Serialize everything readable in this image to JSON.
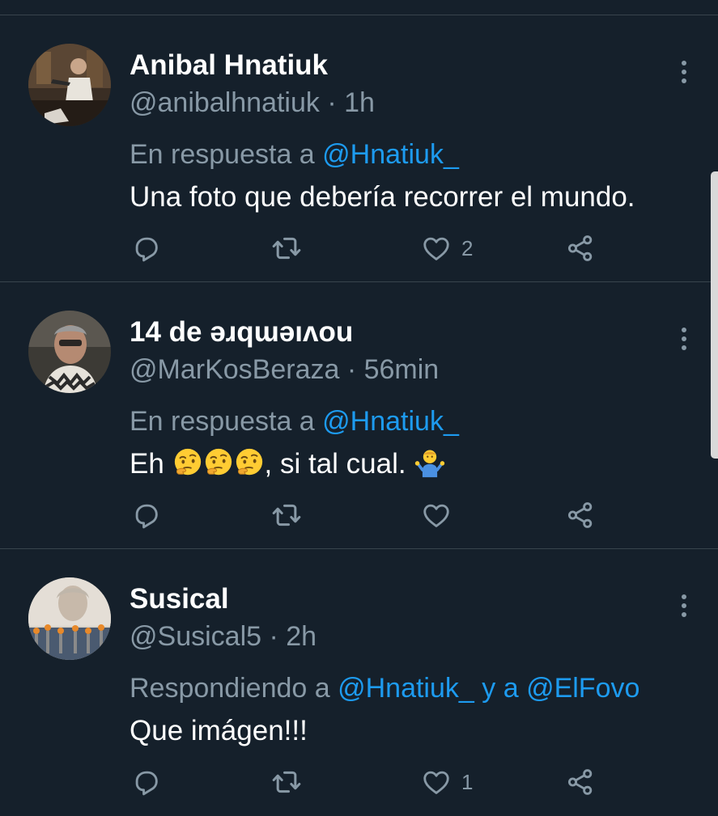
{
  "colors": {
    "background": "#15202b",
    "divider": "#38444d",
    "secondary_text": "#8899a6",
    "accent": "#1d9bf0",
    "primary_text": "#ffffff"
  },
  "tweets": [
    {
      "name": "Anibal Hnatiuk",
      "handle": "@anibalhnatiuk",
      "separator": " · ",
      "time": "1h",
      "reply_prefix": "En respuesta a ",
      "reply_to": "@Hnatiuk_",
      "text": "Una foto que debería recorrer el mundo.",
      "likes": "2",
      "avatar_icon": "avatar-anibal"
    },
    {
      "name": "14 de ǝɹqɯǝıʌou",
      "handle": "@MarKosBeraza",
      "separator": " · ",
      "time": "56min",
      "reply_prefix": "En respuesta a ",
      "reply_to": "@Hnatiuk_",
      "text_start": "Eh ",
      "text_end": ", si tal cual. ",
      "emojis": [
        "thinking-face-emoji",
        "thinking-face-emoji",
        "thinking-face-emoji",
        "man-shrugging-emoji"
      ],
      "likes": "",
      "avatar_icon": "avatar-markos"
    },
    {
      "name": "Susical",
      "handle": "@Susical5",
      "separator": " · ",
      "time": "2h",
      "reply_prefix": "Respondiendo a ",
      "reply_to": "@Hnatiuk_",
      "reply_joiner": " y a ",
      "reply_to_2": "@ElFovo",
      "text": "Que imágen!!!",
      "likes": "1",
      "avatar_icon": "avatar-susical"
    }
  ],
  "icons": {
    "reply": "reply-icon",
    "retweet": "retweet-icon",
    "like": "heart-icon",
    "share": "share-icon",
    "more": "more-vertical-icon"
  }
}
